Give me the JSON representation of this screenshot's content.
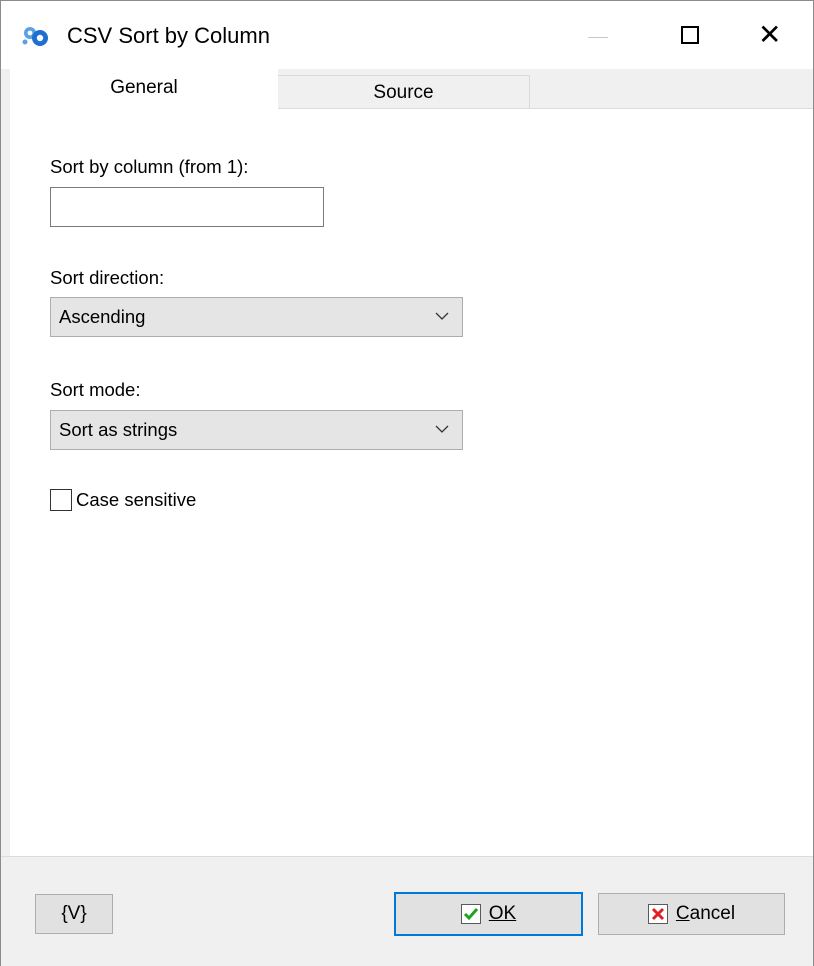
{
  "window": {
    "title": "CSV Sort by Column",
    "icon": "gears-icon",
    "controls": [
      "minimize-icon",
      "maximize-icon",
      "close-icon"
    ]
  },
  "tabs": [
    {
      "label": "General",
      "active": true
    },
    {
      "label": "Source",
      "active": false
    }
  ],
  "general": {
    "column_label": "Sort by column (from 1):",
    "column_value": "",
    "direction_label": "Sort direction:",
    "direction_value": "Ascending",
    "mode_label": "Sort mode:",
    "mode_value": "Sort as strings",
    "case_label": "Case sensitive",
    "case_checked": false
  },
  "footer": {
    "variables_label": "{V}",
    "ok_label": "OK",
    "cancel_label": "Cancel"
  },
  "colors": {
    "focus_border": "#0078d7",
    "ok_check": "#1fa31f",
    "cancel_x": "#e02020",
    "icon_blue": "#1e6fd0"
  }
}
